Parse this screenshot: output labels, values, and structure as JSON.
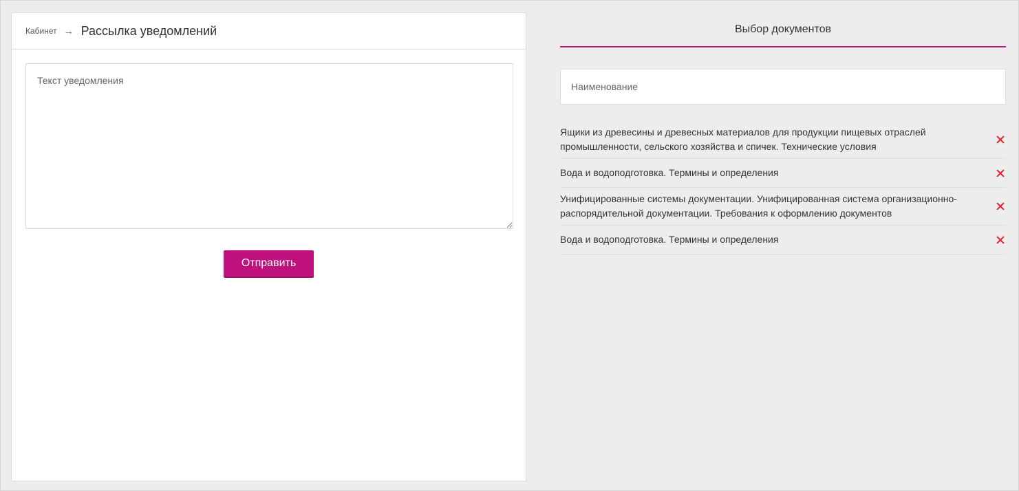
{
  "breadcrumb": {
    "parent": "Кабинет",
    "arrow": "→",
    "current": "Рассылка уведомлений"
  },
  "notification": {
    "placeholder": "Текст уведомления",
    "value": ""
  },
  "send_button": {
    "label": "Отправить"
  },
  "documents": {
    "title": "Выбор документов",
    "search_placeholder": "Наименование",
    "items": [
      {
        "label": "Ящики из древесины и древесных материалов для продукции пищевых отраслей промышленности, сельского хозяйства и спичек. Технические условия"
      },
      {
        "label": "Вода и водоподготовка. Термины и определения"
      },
      {
        "label": "Унифицированные системы документации. Унифицированная система организационно-распорядительной документации. Требования к оформлению документов"
      },
      {
        "label": "Вода и водоподготовка. Термины и определения"
      }
    ]
  },
  "colors": {
    "accent": "#c0127f",
    "remove": "#e5202a",
    "background": "#ededed"
  },
  "icons": {
    "breadcrumb_separator": "arrow-right-icon",
    "remove": "close-icon"
  }
}
